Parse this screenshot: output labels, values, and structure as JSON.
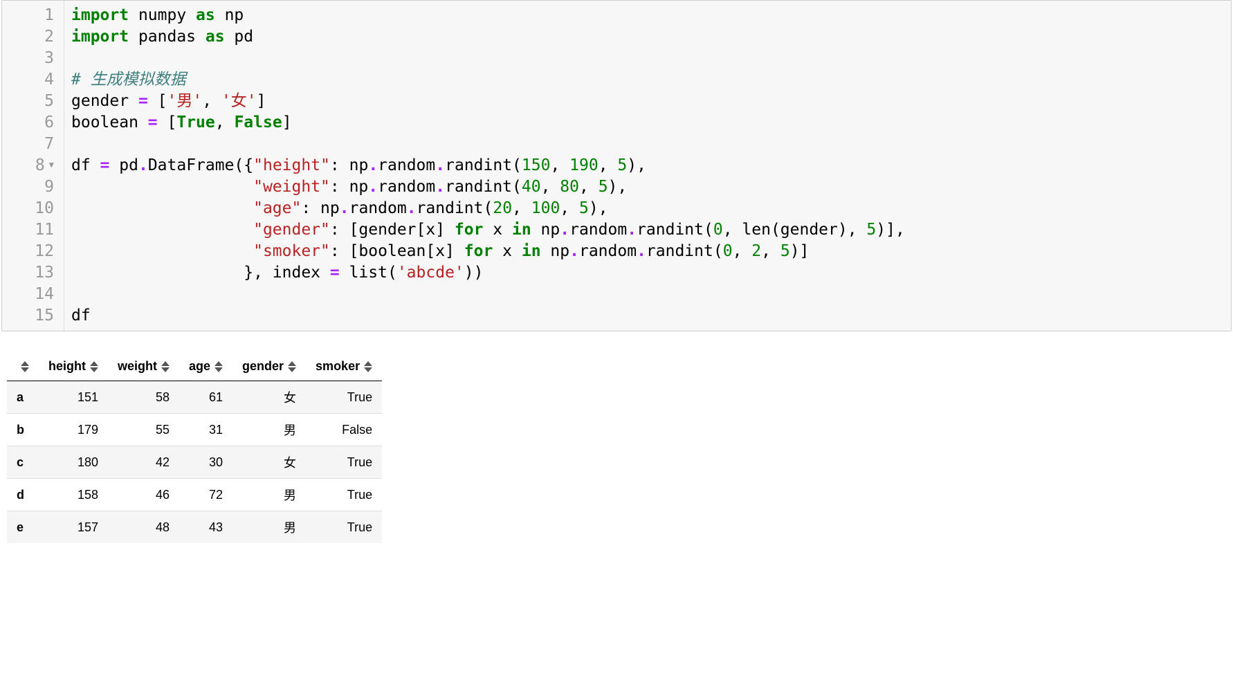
{
  "code": {
    "line_numbers": [
      "1",
      "2",
      "3",
      "4",
      "5",
      "6",
      "7",
      "8",
      "9",
      "10",
      "11",
      "12",
      "13",
      "14",
      "15"
    ],
    "lines": [
      [
        {
          "t": "import",
          "c": "kw"
        },
        {
          "t": " numpy ",
          "c": "nm"
        },
        {
          "t": "as",
          "c": "kw"
        },
        {
          "t": " np",
          "c": "nm"
        }
      ],
      [
        {
          "t": "import",
          "c": "kw"
        },
        {
          "t": " pandas ",
          "c": "nm"
        },
        {
          "t": "as",
          "c": "kw"
        },
        {
          "t": " pd",
          "c": "nm"
        }
      ],
      [],
      [
        {
          "t": "# 生成模拟数据",
          "c": "cm"
        }
      ],
      [
        {
          "t": "gender ",
          "c": "nm"
        },
        {
          "t": "=",
          "c": "op"
        },
        {
          "t": " [",
          "c": "nm"
        },
        {
          "t": "'男'",
          "c": "st"
        },
        {
          "t": ", ",
          "c": "nm"
        },
        {
          "t": "'女'",
          "c": "st"
        },
        {
          "t": "]",
          "c": "nm"
        }
      ],
      [
        {
          "t": "boolean ",
          "c": "nm"
        },
        {
          "t": "=",
          "c": "op"
        },
        {
          "t": " [",
          "c": "nm"
        },
        {
          "t": "True",
          "c": "bl"
        },
        {
          "t": ", ",
          "c": "nm"
        },
        {
          "t": "False",
          "c": "bl"
        },
        {
          "t": "]",
          "c": "nm"
        }
      ],
      [],
      [
        {
          "t": "df ",
          "c": "nm"
        },
        {
          "t": "=",
          "c": "op"
        },
        {
          "t": " pd",
          "c": "nm"
        },
        {
          "t": ".",
          "c": "op"
        },
        {
          "t": "DataFrame({",
          "c": "nm"
        },
        {
          "t": "\"height\"",
          "c": "st"
        },
        {
          "t": ": np",
          "c": "nm"
        },
        {
          "t": ".",
          "c": "op"
        },
        {
          "t": "random",
          "c": "nm"
        },
        {
          "t": ".",
          "c": "op"
        },
        {
          "t": "randint(",
          "c": "nm"
        },
        {
          "t": "150",
          "c": "num"
        },
        {
          "t": ", ",
          "c": "nm"
        },
        {
          "t": "190",
          "c": "num"
        },
        {
          "t": ", ",
          "c": "nm"
        },
        {
          "t": "5",
          "c": "num"
        },
        {
          "t": "),",
          "c": "nm"
        }
      ],
      [
        {
          "t": "                   ",
          "c": "nm"
        },
        {
          "t": "\"weight\"",
          "c": "st"
        },
        {
          "t": ": np",
          "c": "nm"
        },
        {
          "t": ".",
          "c": "op"
        },
        {
          "t": "random",
          "c": "nm"
        },
        {
          "t": ".",
          "c": "op"
        },
        {
          "t": "randint(",
          "c": "nm"
        },
        {
          "t": "40",
          "c": "num"
        },
        {
          "t": ", ",
          "c": "nm"
        },
        {
          "t": "80",
          "c": "num"
        },
        {
          "t": ", ",
          "c": "nm"
        },
        {
          "t": "5",
          "c": "num"
        },
        {
          "t": "),",
          "c": "nm"
        }
      ],
      [
        {
          "t": "                   ",
          "c": "nm"
        },
        {
          "t": "\"age\"",
          "c": "st"
        },
        {
          "t": ": np",
          "c": "nm"
        },
        {
          "t": ".",
          "c": "op"
        },
        {
          "t": "random",
          "c": "nm"
        },
        {
          "t": ".",
          "c": "op"
        },
        {
          "t": "randint(",
          "c": "nm"
        },
        {
          "t": "20",
          "c": "num"
        },
        {
          "t": ", ",
          "c": "nm"
        },
        {
          "t": "100",
          "c": "num"
        },
        {
          "t": ", ",
          "c": "nm"
        },
        {
          "t": "5",
          "c": "num"
        },
        {
          "t": "),",
          "c": "nm"
        }
      ],
      [
        {
          "t": "                   ",
          "c": "nm"
        },
        {
          "t": "\"gender\"",
          "c": "st"
        },
        {
          "t": ": [gender[x] ",
          "c": "nm"
        },
        {
          "t": "for",
          "c": "kw"
        },
        {
          "t": " x ",
          "c": "nm"
        },
        {
          "t": "in",
          "c": "kw"
        },
        {
          "t": " np",
          "c": "nm"
        },
        {
          "t": ".",
          "c": "op"
        },
        {
          "t": "random",
          "c": "nm"
        },
        {
          "t": ".",
          "c": "op"
        },
        {
          "t": "randint(",
          "c": "nm"
        },
        {
          "t": "0",
          "c": "num"
        },
        {
          "t": ", len(gender), ",
          "c": "nm"
        },
        {
          "t": "5",
          "c": "num"
        },
        {
          "t": ")],",
          "c": "nm"
        }
      ],
      [
        {
          "t": "                   ",
          "c": "nm"
        },
        {
          "t": "\"smoker\"",
          "c": "st"
        },
        {
          "t": ": [boolean[x] ",
          "c": "nm"
        },
        {
          "t": "for",
          "c": "kw"
        },
        {
          "t": " x ",
          "c": "nm"
        },
        {
          "t": "in",
          "c": "kw"
        },
        {
          "t": " np",
          "c": "nm"
        },
        {
          "t": ".",
          "c": "op"
        },
        {
          "t": "random",
          "c": "nm"
        },
        {
          "t": ".",
          "c": "op"
        },
        {
          "t": "randint(",
          "c": "nm"
        },
        {
          "t": "0",
          "c": "num"
        },
        {
          "t": ", ",
          "c": "nm"
        },
        {
          "t": "2",
          "c": "num"
        },
        {
          "t": ", ",
          "c": "nm"
        },
        {
          "t": "5",
          "c": "num"
        },
        {
          "t": ")]",
          "c": "nm"
        }
      ],
      [
        {
          "t": "                  }, index ",
          "c": "nm"
        },
        {
          "t": "=",
          "c": "op"
        },
        {
          "t": " list(",
          "c": "nm"
        },
        {
          "t": "'abcde'",
          "c": "st"
        },
        {
          "t": "))",
          "c": "nm"
        }
      ],
      [],
      [
        {
          "t": "df",
          "c": "nm"
        }
      ]
    ],
    "fold_line": 8
  },
  "output_table": {
    "columns": [
      "height",
      "weight",
      "age",
      "gender",
      "smoker"
    ],
    "index": [
      "a",
      "b",
      "c",
      "d",
      "e"
    ],
    "rows": [
      [
        "151",
        "58",
        "61",
        "女",
        "True"
      ],
      [
        "179",
        "55",
        "31",
        "男",
        "False"
      ],
      [
        "180",
        "42",
        "30",
        "女",
        "True"
      ],
      [
        "158",
        "46",
        "72",
        "男",
        "True"
      ],
      [
        "157",
        "48",
        "43",
        "男",
        "True"
      ]
    ]
  },
  "chart_data": {
    "type": "table",
    "columns": [
      "height",
      "weight",
      "age",
      "gender",
      "smoker"
    ],
    "index": [
      "a",
      "b",
      "c",
      "d",
      "e"
    ],
    "data": [
      [
        151,
        58,
        61,
        "女",
        "True"
      ],
      [
        179,
        55,
        31,
        "男",
        "False"
      ],
      [
        180,
        42,
        30,
        "女",
        "True"
      ],
      [
        158,
        46,
        72,
        "男",
        "True"
      ],
      [
        157,
        48,
        43,
        "男",
        "True"
      ]
    ]
  }
}
